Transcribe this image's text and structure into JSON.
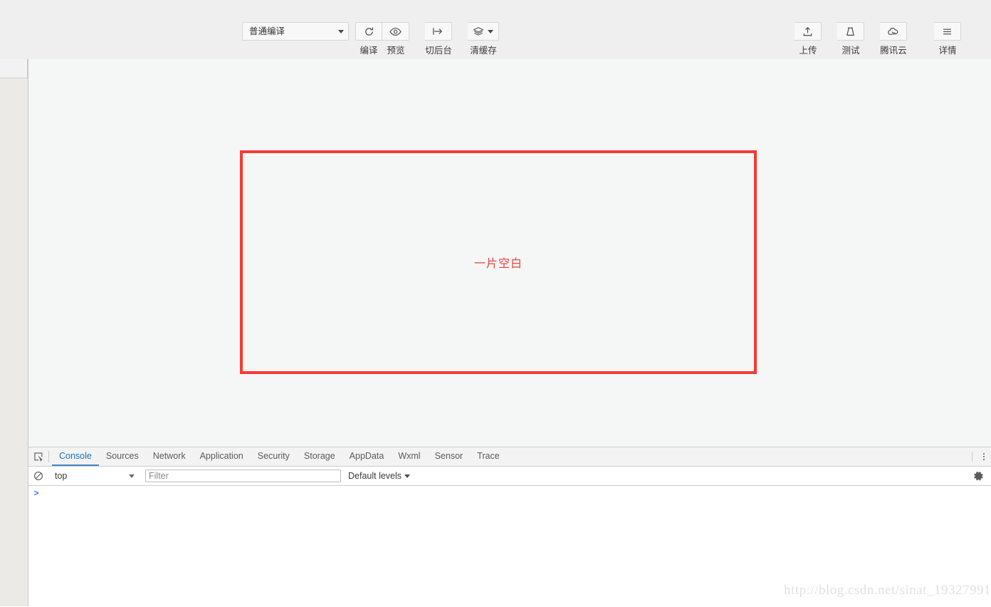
{
  "toolbar": {
    "compile_mode": {
      "value": "普通编译",
      "icon": "chevron-down-icon"
    },
    "left_buttons": [
      {
        "label": "编译",
        "icon": "refresh-icon"
      },
      {
        "label": "预览",
        "icon": "eye-icon"
      },
      {
        "label": "切后台",
        "icon": "arrow-to-bar-icon"
      },
      {
        "label": "清缓存",
        "icon": "layers-icon",
        "has_dropdown": true
      }
    ],
    "right_buttons": [
      {
        "label": "上传",
        "icon": "upload-icon"
      },
      {
        "label": "测试",
        "icon": "flask-icon"
      },
      {
        "label": "腾讯云",
        "icon": "cloud-icon"
      },
      {
        "label": "详情",
        "icon": "hamburger-icon"
      }
    ]
  },
  "simulator": {
    "blank_notice": "一片空白",
    "blank_notice_color": "#e8443c",
    "background_color": "#f5f6f6"
  },
  "devtools": {
    "inspect_icon": "inspect-element-icon",
    "more_icon": "vertical-dots-icon",
    "tabs": [
      {
        "label": "Console",
        "active": true
      },
      {
        "label": "Sources",
        "active": false
      },
      {
        "label": "Network",
        "active": false
      },
      {
        "label": "Application",
        "active": false
      },
      {
        "label": "Security",
        "active": false
      },
      {
        "label": "Storage",
        "active": false
      },
      {
        "label": "AppData",
        "active": false
      },
      {
        "label": "Wxml",
        "active": false
      },
      {
        "label": "Sensor",
        "active": false
      },
      {
        "label": "Trace",
        "active": false
      }
    ],
    "console": {
      "clear_icon": "clear-console-icon",
      "context": "top",
      "filter_placeholder": "Filter",
      "filter_value": "",
      "levels": "Default levels",
      "settings_icon": "gear-icon",
      "prompt_symbol": ">",
      "prompt_value": "",
      "messages": []
    }
  },
  "watermark": {
    "text": "http://blog.csdn.net/sinat_19327991"
  }
}
